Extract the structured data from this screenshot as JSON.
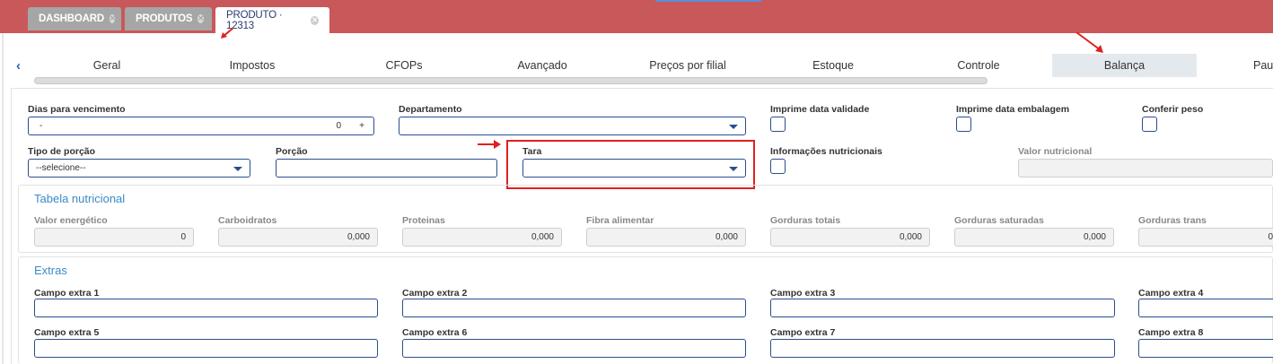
{
  "top_tabs": [
    {
      "label": "DASHBOARD",
      "close": "✕"
    },
    {
      "label": "PRODUTOS",
      "close": "✕"
    },
    {
      "label": "PRODUTO · 12313",
      "close": "✕"
    }
  ],
  "sub_tabs": [
    {
      "label": "Geral"
    },
    {
      "label": "Impostos"
    },
    {
      "label": "CFOPs"
    },
    {
      "label": "Avançado"
    },
    {
      "label": "Preços por filial"
    },
    {
      "label": "Estoque"
    },
    {
      "label": "Controle"
    },
    {
      "label": "Balança"
    },
    {
      "label": "Paut"
    }
  ],
  "form": {
    "dias_vencimento": {
      "label": "Dias para vencimento",
      "minus": "-",
      "value": "0",
      "plus": "+"
    },
    "departamento": {
      "label": "Departamento",
      "value": ""
    },
    "imprime_validade": {
      "label": "Imprime data validade"
    },
    "imprime_embalagem": {
      "label": "Imprime data embalagem"
    },
    "conferir_peso": {
      "label": "Conferir peso"
    },
    "tipo_porcao": {
      "label": "Tipo de porção",
      "value": "--selecione--"
    },
    "porcao": {
      "label": "Porção",
      "value": ""
    },
    "tara": {
      "label": "Tara",
      "value": ""
    },
    "info_nutricionais": {
      "label": "Informações nutricionais"
    },
    "valor_nutricional": {
      "label": "Valor nutricional",
      "value": ""
    }
  },
  "tabela_nutricional": {
    "title": "Tabela nutricional",
    "fields": [
      {
        "label": "Valor energético",
        "value": "0"
      },
      {
        "label": "Carboidratos",
        "value": "0,000"
      },
      {
        "label": "Proteinas",
        "value": "0,000"
      },
      {
        "label": "Fibra alimentar",
        "value": "0,000"
      },
      {
        "label": "Gorduras totais",
        "value": "0,000"
      },
      {
        "label": "Gorduras saturadas",
        "value": "0,000"
      },
      {
        "label": "Gorduras trans",
        "value": "0"
      }
    ]
  },
  "extras": {
    "title": "Extras",
    "fields": [
      {
        "label": "Campo extra 1"
      },
      {
        "label": "Campo extra 2"
      },
      {
        "label": "Campo extra 3"
      },
      {
        "label": "Campo extra 4"
      },
      {
        "label": "Campo extra 5"
      },
      {
        "label": "Campo extra 6"
      },
      {
        "label": "Campo extra 7"
      },
      {
        "label": "Campo extra 8"
      }
    ]
  },
  "colors": {
    "header": "#c9585a",
    "accent": "#2a4d8f",
    "section_title": "#3a8bc9",
    "highlight": "#e02020"
  }
}
